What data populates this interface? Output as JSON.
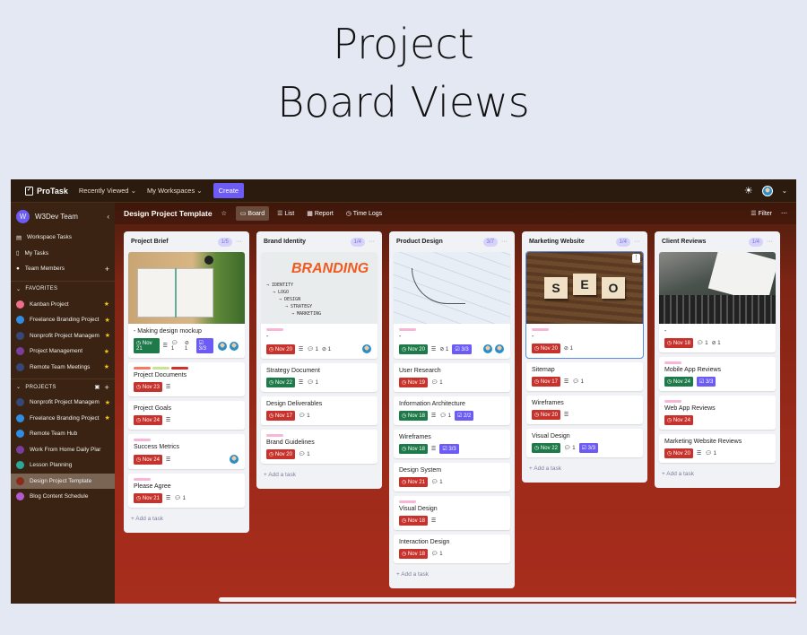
{
  "hero": {
    "line1": "Project",
    "line2": "Board Views"
  },
  "topbar": {
    "brand": "ProTask",
    "recently_viewed": "Recently Viewed",
    "my_workspaces": "My Workspaces",
    "create": "Create"
  },
  "sidebar": {
    "team": "W3Dev Team",
    "team_initial": "W",
    "nav": [
      "Workspace Tasks",
      "My Tasks",
      "Team Members"
    ],
    "favorites_title": "FAVORITES",
    "favorites": [
      {
        "label": "Kanban Project",
        "color": "#f06e8c",
        "star": true
      },
      {
        "label": "Freelance Branding Project",
        "color": "#2f8de4",
        "star": true
      },
      {
        "label": "Nonprofit Project Managem",
        "color": "#34497a",
        "star": true
      },
      {
        "label": "Project Management",
        "color": "#7a3ea0",
        "star": true
      },
      {
        "label": "Remote Team Meetings",
        "color": "#34497a",
        "star": true
      }
    ],
    "projects_title": "PROJECTS",
    "projects": [
      {
        "label": "Nonprofit Project Managem",
        "color": "#34497a",
        "star": true
      },
      {
        "label": "Freelance Branding Project",
        "color": "#2f8de4",
        "star": true
      },
      {
        "label": "Remote Team Hub",
        "color": "#2f8de4",
        "star": false
      },
      {
        "label": "Work From Home Daily Plar",
        "color": "#7a3ea0",
        "star": false
      },
      {
        "label": "Lesson Planning",
        "color": "#2aa89a",
        "star": false
      },
      {
        "label": "Design Project Template",
        "color": "#8a2a1a",
        "star": false,
        "active": true
      },
      {
        "label": "Blog Content Schedule",
        "color": "#b45ad0",
        "star": false
      }
    ]
  },
  "board": {
    "title": "Design Project Template",
    "tabs": [
      "Board",
      "List",
      "Report",
      "Time Logs"
    ],
    "active_tab": "Board",
    "filter": "Filter",
    "add_task": "+ Add a task"
  },
  "colors": {
    "green": "#1f7a4a",
    "red": "#c8322c",
    "checklist": "#6c5cf5",
    "pink": "#f7b6d8"
  },
  "columns": [
    {
      "title": "Project Brief",
      "count": "1/5",
      "cards": [
        {
          "image": "notebook",
          "title": "- Making design mockup",
          "date": "Nov 21",
          "status": "green",
          "desc": true,
          "comments": "1",
          "attach": "1",
          "check": "3/3",
          "avatars": 2
        },
        {
          "labels": [
            "#f47a64",
            "#c8e58e",
            "#d0322a"
          ],
          "title": "Project Documents",
          "date": "Nov 23",
          "status": "red",
          "desc": true
        },
        {
          "title": "Project Goals",
          "date": "Nov 24",
          "status": "red",
          "desc": true
        },
        {
          "labels": [
            "#f7b6d8"
          ],
          "title": "Success Metrics",
          "date": "Nov 24",
          "status": "red",
          "desc": true,
          "avatars": 1
        },
        {
          "labels": [
            "#f7b6d8"
          ],
          "title": "Please Agree",
          "date": "Nov 21",
          "status": "red",
          "desc": true,
          "comments": "1"
        }
      ]
    },
    {
      "title": "Brand Identity",
      "count": "1/4",
      "cards": [
        {
          "image": "branding",
          "labels": [
            "#f7b6d8"
          ],
          "title": "-",
          "date": "Nov 20",
          "status": "red",
          "desc": true,
          "comments": "1",
          "attach": "1",
          "avatars": 1
        },
        {
          "title": "Strategy Document",
          "date": "Nov 22",
          "status": "green",
          "desc": true,
          "comments": "1"
        },
        {
          "title": "Design Deliverables",
          "date": "Nov 17",
          "status": "red",
          "comments": "1"
        },
        {
          "labels": [
            "#f7b6d8"
          ],
          "title": "Brand Guidelines",
          "date": "Nov 20",
          "status": "red",
          "comments": "1"
        }
      ]
    },
    {
      "title": "Product Design",
      "count": "3/7",
      "cards": [
        {
          "image": "sketch",
          "labels": [
            "#f7b6d8"
          ],
          "title": "-",
          "date": "Nov 20",
          "status": "green",
          "desc": true,
          "attach": "1",
          "check": "3/3",
          "avatars": 2
        },
        {
          "title": "User Research",
          "date": "Nov 19",
          "status": "red",
          "comments": "1"
        },
        {
          "title": "Information Architecture",
          "date": "Nov 18",
          "status": "green",
          "desc": true,
          "comments": "1",
          "check": "2/2"
        },
        {
          "title": "Wireframes",
          "date": "Nov 18",
          "status": "green",
          "desc": true,
          "check": "3/3"
        },
        {
          "title": "Design System",
          "date": "Nov 21",
          "status": "red",
          "comments": "1"
        },
        {
          "labels": [
            "#f7b6d8"
          ],
          "title": "Visual Design",
          "date": "Nov 18",
          "status": "red",
          "desc": true
        },
        {
          "title": "Interaction Design",
          "date": "Nov 18",
          "status": "red",
          "comments": "1"
        }
      ]
    },
    {
      "title": "Marketing Website",
      "count": "1/4",
      "cards": [
        {
          "image": "seo",
          "selected": true,
          "labels": [
            "#f7b6d8"
          ],
          "title": "-",
          "date": "Nov 20",
          "status": "red",
          "attach": "1"
        },
        {
          "title": "Sitemap",
          "date": "Nov 17",
          "status": "red",
          "desc": true,
          "comments": "1"
        },
        {
          "title": "Wireframes",
          "date": "Nov 20",
          "status": "red",
          "desc": true
        },
        {
          "title": "Visual Design",
          "date": "Nov 22",
          "status": "green",
          "comments": "1",
          "check": "3/3"
        }
      ]
    },
    {
      "title": "Client Reviews",
      "count": "1/4",
      "cards": [
        {
          "image": "typewriter",
          "title": "-",
          "date": "Nov 18",
          "status": "red",
          "comments": "1",
          "attach": "1"
        },
        {
          "labels": [
            "#f7b6d8"
          ],
          "title": "Mobile App Reviews",
          "date": "Nov 24",
          "status": "green",
          "check": "3/3"
        },
        {
          "labels": [
            "#f7b6d8"
          ],
          "title": "Web App Reviews",
          "date": "Nov 24",
          "status": "red"
        },
        {
          "title": "Marketing Website Reviews",
          "date": "Nov 20",
          "status": "red",
          "desc": true,
          "comments": "1"
        }
      ]
    }
  ],
  "image_texts": {
    "branding": "BRANDING",
    "branding_lines": [
      "IDENTITY",
      "LOGO",
      "DESIGN",
      "STRATEGY",
      "MARKETING"
    ],
    "seo": [
      "S",
      "E",
      "O"
    ]
  }
}
